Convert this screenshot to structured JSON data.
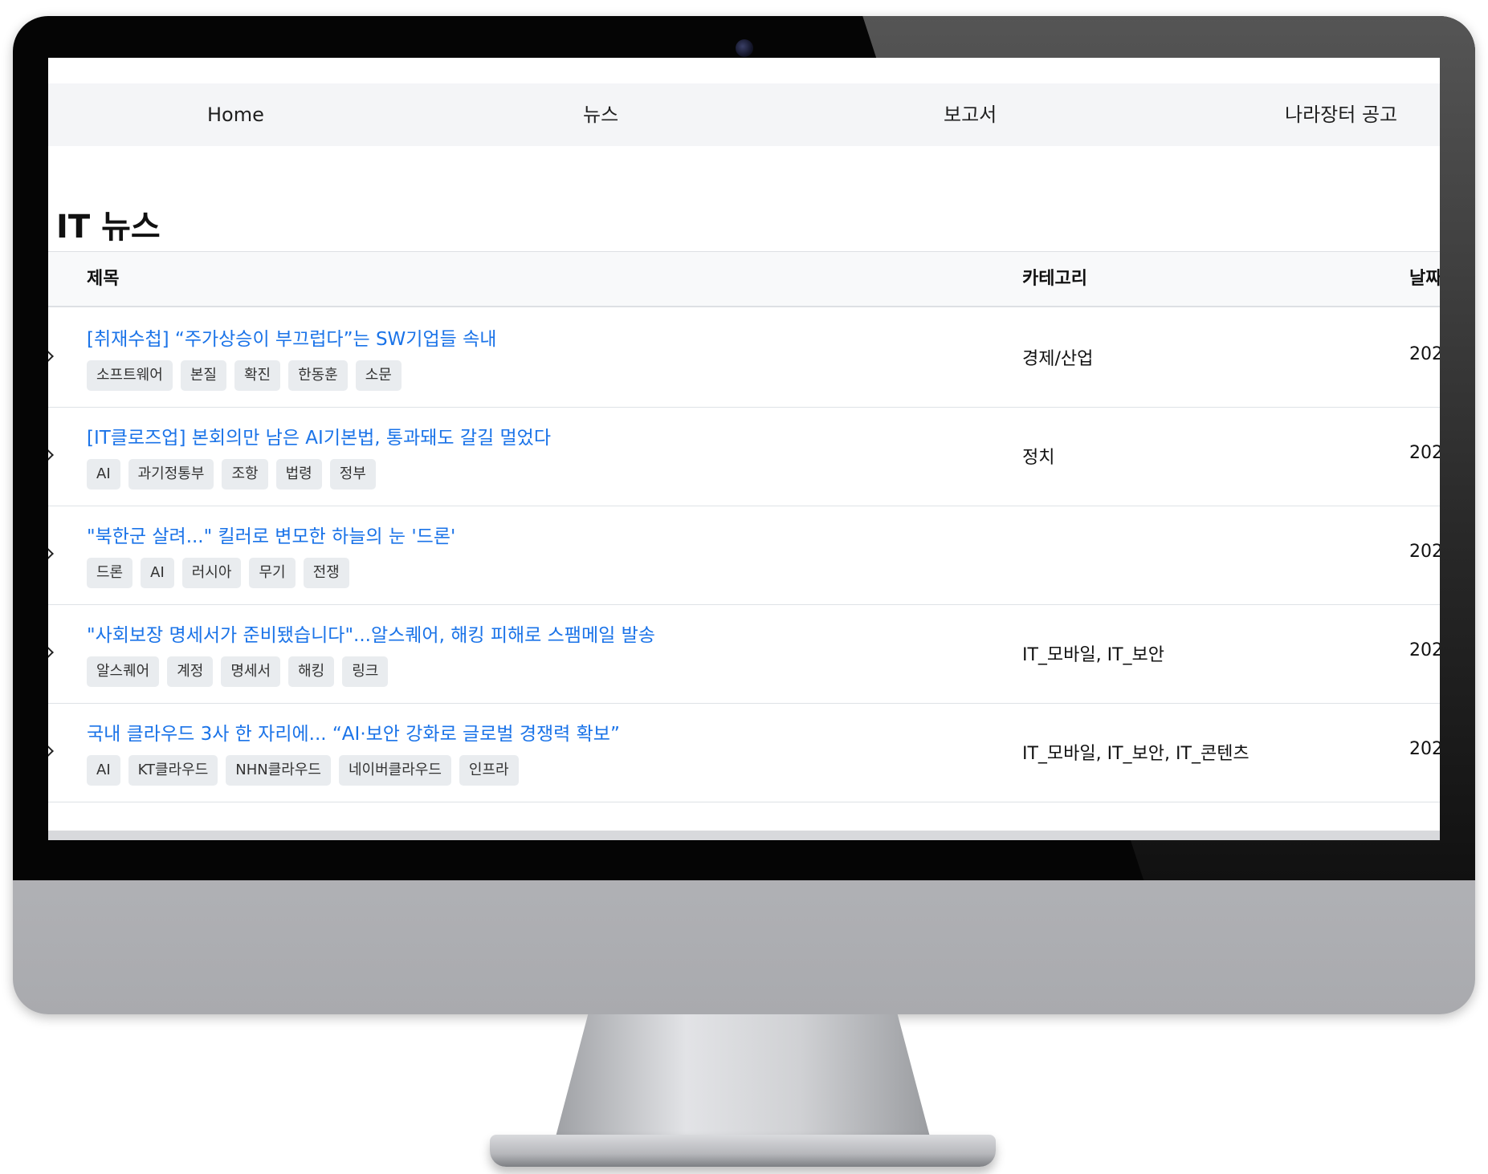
{
  "nav": {
    "items": [
      {
        "label": "Home"
      },
      {
        "label": "뉴스"
      },
      {
        "label": "보고서"
      },
      {
        "label": "나라장터 공고"
      }
    ]
  },
  "page": {
    "title": "IT 뉴스"
  },
  "table": {
    "headers": {
      "title": "제목",
      "category": "카테고리",
      "date": "날짜"
    },
    "rows": [
      {
        "title": "[취재수첩] “주가상승이 부끄럽다”는 SW기업들 속내",
        "tags": [
          "소프트웨어",
          "본질",
          "확진",
          "한동훈",
          "소문"
        ],
        "category": "경제/산업",
        "date": "202"
      },
      {
        "title": "[IT클로즈업] 본회의만 남은 AI기본법, 통과돼도 갈길 멀었다",
        "tags": [
          "AI",
          "과기정통부",
          "조항",
          "법령",
          "정부"
        ],
        "category": "정치",
        "date": "202"
      },
      {
        "title": "\"북한군 살려...\" 킬러로 변모한 하늘의 눈 '드론'",
        "tags": [
          "드론",
          "AI",
          "러시아",
          "무기",
          "전쟁"
        ],
        "category": "",
        "date": "202"
      },
      {
        "title": "\"사회보장 명세서가 준비됐습니다\"...알스퀘어, 해킹 피해로 스팸메일 발송",
        "tags": [
          "알스퀘어",
          "계정",
          "명세서",
          "해킹",
          "링크"
        ],
        "category": "IT_모바일, IT_보안",
        "date": "202"
      },
      {
        "title": "국내 클라우드 3사 한 자리에... “AI·보안 강화로 글로벌 경쟁력 확보”",
        "tags": [
          "AI",
          "KT클라우드",
          "NHN클라우드",
          "네이버클라우드",
          "인프라"
        ],
        "category": "IT_모바일, IT_보안, IT_콘텐츠",
        "date": "202"
      }
    ]
  }
}
